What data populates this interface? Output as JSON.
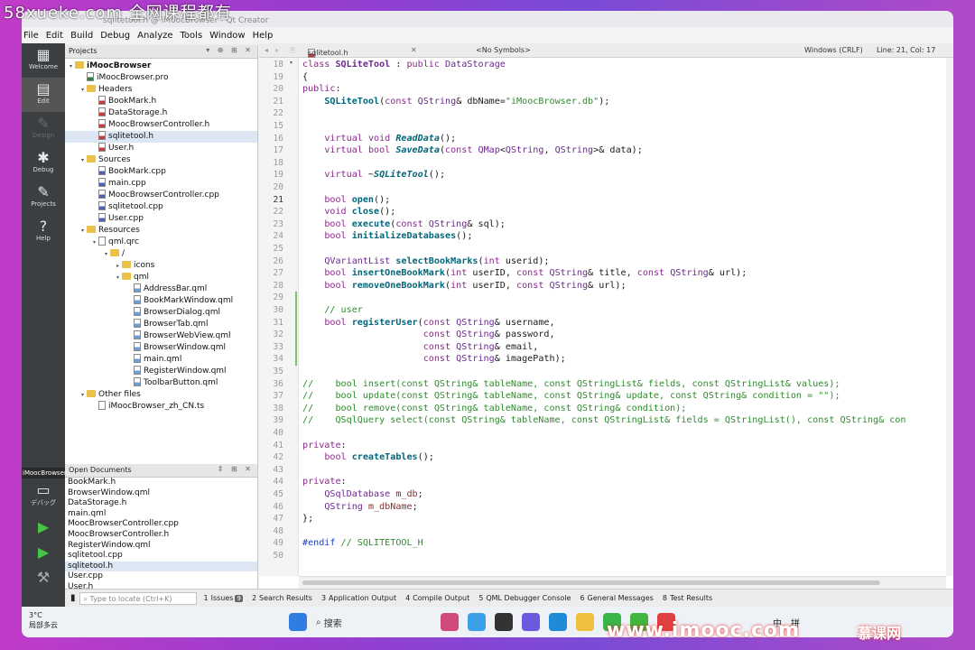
{
  "watermark": {
    "top_text": "58xueke.com 全网课程都有",
    "bottom_url": "www.imooc.com",
    "bottom_logo": "慕课网",
    "center_text": "58xueke.com"
  },
  "window": {
    "title": "sqlitetool.h @ iMoocBrowser - Qt Creator"
  },
  "menu": [
    "File",
    "Edit",
    "Build",
    "Debug",
    "Analyze",
    "Tools",
    "Window",
    "Help"
  ],
  "mode_rail": [
    {
      "label": "Welcome",
      "icon": "grid-icon"
    },
    {
      "label": "Edit",
      "icon": "edit-icon"
    },
    {
      "label": "Design",
      "icon": "pen-icon"
    },
    {
      "label": "Debug",
      "icon": "bug-icon"
    },
    {
      "label": "Projects",
      "icon": "wrench-icon"
    },
    {
      "label": "Help",
      "icon": "help-icon"
    }
  ],
  "kit": {
    "project": "iMoocBrowser",
    "config": "デバッグ"
  },
  "projects_panel": {
    "title": "Projects"
  },
  "tree": [
    {
      "label": "iMoocBrowser",
      "kind": "project",
      "level": 0,
      "arrow": "▾"
    },
    {
      "label": "iMoocBrowser.pro",
      "kind": "pro",
      "level": 1,
      "arrow": ""
    },
    {
      "label": "Headers",
      "kind": "folder",
      "level": 1,
      "arrow": "▾"
    },
    {
      "label": "BookMark.h",
      "kind": "h",
      "level": 2,
      "arrow": ""
    },
    {
      "label": "DataStorage.h",
      "kind": "h",
      "level": 2,
      "arrow": ""
    },
    {
      "label": "MoocBrowserController.h",
      "kind": "h",
      "level": 2,
      "arrow": ""
    },
    {
      "label": "sqlitetool.h",
      "kind": "h",
      "level": 2,
      "arrow": "",
      "selected": true
    },
    {
      "label": "User.h",
      "kind": "h",
      "level": 2,
      "arrow": ""
    },
    {
      "label": "Sources",
      "kind": "folder",
      "level": 1,
      "arrow": "▾"
    },
    {
      "label": "BookMark.cpp",
      "kind": "cpp",
      "level": 2,
      "arrow": ""
    },
    {
      "label": "main.cpp",
      "kind": "cpp",
      "level": 2,
      "arrow": ""
    },
    {
      "label": "MoocBrowserController.cpp",
      "kind": "cpp",
      "level": 2,
      "arrow": ""
    },
    {
      "label": "sqlitetool.cpp",
      "kind": "cpp",
      "level": 2,
      "arrow": ""
    },
    {
      "label": "User.cpp",
      "kind": "cpp",
      "level": 2,
      "arrow": ""
    },
    {
      "label": "Resources",
      "kind": "folder",
      "level": 1,
      "arrow": "▾"
    },
    {
      "label": "qml.qrc",
      "kind": "qrc",
      "level": 2,
      "arrow": "▾"
    },
    {
      "label": "/",
      "kind": "folder",
      "level": 3,
      "arrow": "▾"
    },
    {
      "label": "icons",
      "kind": "folder",
      "level": 4,
      "arrow": "▸"
    },
    {
      "label": "qml",
      "kind": "folder",
      "level": 4,
      "arrow": "▾"
    },
    {
      "label": "AddressBar.qml",
      "kind": "qml",
      "level": 5,
      "arrow": ""
    },
    {
      "label": "BookMarkWindow.qml",
      "kind": "qml",
      "level": 5,
      "arrow": ""
    },
    {
      "label": "BrowserDialog.qml",
      "kind": "qml",
      "level": 5,
      "arrow": ""
    },
    {
      "label": "BrowserTab.qml",
      "kind": "qml",
      "level": 5,
      "arrow": ""
    },
    {
      "label": "BrowserWebView.qml",
      "kind": "qml",
      "level": 5,
      "arrow": ""
    },
    {
      "label": "BrowserWindow.qml",
      "kind": "qml",
      "level": 5,
      "arrow": ""
    },
    {
      "label": "main.qml",
      "kind": "qml",
      "level": 5,
      "arrow": ""
    },
    {
      "label": "RegisterWindow.qml",
      "kind": "qml",
      "level": 5,
      "arrow": ""
    },
    {
      "label": "ToolbarButton.qml",
      "kind": "qml",
      "level": 5,
      "arrow": ""
    },
    {
      "label": "Other files",
      "kind": "folder",
      "level": 1,
      "arrow": "▾"
    },
    {
      "label": "iMoocBrowser_zh_CN.ts",
      "kind": "ts",
      "level": 2,
      "arrow": ""
    }
  ],
  "open_documents": {
    "title": "Open Documents",
    "items": [
      "BookMark.h",
      "BrowserWindow.qml",
      "DataStorage.h",
      "main.qml",
      "MoocBrowserController.cpp",
      "MoocBrowserController.h",
      "RegisterWindow.qml",
      "sqlitetool.cpp",
      "sqlitetool.h",
      "User.cpp",
      "User.h"
    ]
  },
  "editor_toolbar": {
    "file": "sqlitetool.h",
    "symbols": "<No Symbols>",
    "line_ending": "Windows (CRLF)",
    "position": "Line: 21, Col: 17"
  },
  "code_lines": [
    {
      "n": 18,
      "html": "<span style='color:#8a2a8a'>class</span> <b style='color:#6a2a8a'>SQLiteTool</b> : <span style='color:#8a2a8a'>public</span> <span style='color:#6a2a8a'>DataStorage</span>"
    },
    {
      "n": 19,
      "html": "{"
    },
    {
      "n": 20,
      "html": "<span style='color:#8a2a8a'>public</span>:"
    },
    {
      "n": 21,
      "html": "    <b style='color:#00677c'>SQLiteTool</b>(<span style='color:#8a2a8a'>const</span> <span style='color:#6a2a8a'>QString</span>&amp; dbName=<span style='color:#2e8b2e'>\"iMoocBrowser.db\"</span>);"
    },
    {
      "n": 22,
      "html": ""
    },
    {
      "n": 15,
      "html": ""
    },
    {
      "n": 16,
      "html": "    <span style='color:#8a2a8a'>virtual</span> <span style='color:#8a2a8a'>void</span> <b style='color:#00677c;font-style:italic'>ReadData</b>();"
    },
    {
      "n": 17,
      "html": "    <span style='color:#8a2a8a'>virtual</span> <span style='color:#8a2a8a'>bool</span> <b style='color:#00677c;font-style:italic'>SaveData</b>(<span style='color:#8a2a8a'>const</span> <span style='color:#6a2a8a'>QMap</span>&lt;<span style='color:#6a2a8a'>QString</span>, <span style='color:#6a2a8a'>QString</span>&gt;&amp; data);"
    },
    {
      "n": 18,
      "html": ""
    },
    {
      "n": 19,
      "html": "    <span style='color:#8a2a8a'>virtual</span> ~<b style='color:#00677c;font-style:italic'>SQLiteTool</b>();"
    },
    {
      "n": 20,
      "html": ""
    },
    {
      "n": 21,
      "html": "    <span style='color:#8a2a8a'>bool</span> <b style='color:#00677c'>open</b>();"
    },
    {
      "n": 22,
      "html": "    <span style='color:#8a2a8a'>void</span> <b style='color:#00677c'>close</b>();"
    },
    {
      "n": 23,
      "html": "    <span style='color:#8a2a8a'>bool</span> <b style='color:#00677c'>execute</b>(<span style='color:#8a2a8a'>const</span> <span style='color:#6a2a8a'>QString</span>&amp; sql);"
    },
    {
      "n": 24,
      "html": "    <span style='color:#8a2a8a'>bool</span> <b style='color:#00677c'>initializeDatabases</b>();"
    },
    {
      "n": 25,
      "html": ""
    },
    {
      "n": 26,
      "html": "    <span style='color:#6a2a8a'>QVariantList</span> <b style='color:#00677c'>selectBookMarks</b>(<span style='color:#8a2a8a'>int</span> userid);"
    },
    {
      "n": 27,
      "html": "    <span style='color:#8a2a8a'>bool</span> <b style='color:#00677c'>insertOneBookMark</b>(<span style='color:#8a2a8a'>int</span> userID, <span style='color:#8a2a8a'>const</span> <span style='color:#6a2a8a'>QString</span>&amp; title, <span style='color:#8a2a8a'>const</span> <span style='color:#6a2a8a'>QString</span>&amp; url);"
    },
    {
      "n": 28,
      "html": "    <span style='color:#8a2a8a'>bool</span> <b style='color:#00677c'>removeOneBookMark</b>(<span style='color:#8a2a8a'>int</span> userID, <span style='color:#8a2a8a'>const</span> <span style='color:#6a2a8a'>QString</span>&amp; url);"
    },
    {
      "n": 29,
      "html": ""
    },
    {
      "n": 30,
      "html": "    <span style='color:#2e8b2e'>// user</span>"
    },
    {
      "n": 31,
      "html": "    <span style='color:#8a2a8a'>bool</span> <b style='color:#00677c'>registerUser</b>(<span style='color:#8a2a8a'>const</span> <span style='color:#6a2a8a'>QString</span>&amp; username,"
    },
    {
      "n": 32,
      "html": "                      <span style='color:#8a2a8a'>const</span> <span style='color:#6a2a8a'>QString</span>&amp; password,"
    },
    {
      "n": 33,
      "html": "                      <span style='color:#8a2a8a'>const</span> <span style='color:#6a2a8a'>QString</span>&amp; email,"
    },
    {
      "n": 34,
      "html": "                      <span style='color:#8a2a8a'>const</span> <span style='color:#6a2a8a'>QString</span>&amp; imagePath);"
    },
    {
      "n": 35,
      "html": ""
    },
    {
      "n": 36,
      "html": "<span style='color:#2e8b2e'>//    bool insert(const QString&amp; tableName, const QStringList&amp; fields, const QStringList&amp; values);</span>"
    },
    {
      "n": 37,
      "html": "<span style='color:#2e8b2e'>//    bool update(const QString&amp; tableName, const QString&amp; update, const QString&amp; condition = \"\");</span>"
    },
    {
      "n": 38,
      "html": "<span style='color:#2e8b2e'>//    bool remove(const QString&amp; tableName, const QString&amp; condition);</span>"
    },
    {
      "n": 39,
      "html": "<span style='color:#2e8b2e'>//    QSqlQuery select(const QString&amp; tableName, const QStringList&amp; fields = QStringList(), const QString&amp; con</span>"
    },
    {
      "n": 40,
      "html": ""
    },
    {
      "n": 41,
      "html": "<span style='color:#8a2a8a'>private</span>:"
    },
    {
      "n": 42,
      "html": "    <span style='color:#8a2a8a'>bool</span> <b style='color:#00677c'>createTables</b>();"
    },
    {
      "n": 43,
      "html": ""
    },
    {
      "n": 44,
      "html": "<span style='color:#8a2a8a'>private</span>:"
    },
    {
      "n": 45,
      "html": "    <span style='color:#6a2a8a'>QSqlDatabase</span> <span style='color:#8a2a2a'>m_db</span>;"
    },
    {
      "n": 46,
      "html": "    <span style='color:#6a2a8a'>QString</span> <span style='color:#8a2a2a'>m_dbName</span>;"
    },
    {
      "n": 47,
      "html": "};"
    },
    {
      "n": 48,
      "html": ""
    },
    {
      "n": 49,
      "html": "<span style='color:#1f3fbf'>#endif</span> <span style='color:#2e8b2e'>// SQLITETOOL_H</span>"
    },
    {
      "n": 50,
      "html": ""
    }
  ],
  "statusbar": {
    "locate_placeholder": "Type to locate (Ctrl+K)",
    "items": [
      {
        "num": "1",
        "label": "Issues",
        "badge": "9"
      },
      {
        "num": "2",
        "label": "Search Results"
      },
      {
        "num": "3",
        "label": "Application Output"
      },
      {
        "num": "4",
        "label": "Compile Output"
      },
      {
        "num": "5",
        "label": "QML Debugger Console"
      },
      {
        "num": "6",
        "label": "General Messages"
      },
      {
        "num": "8",
        "label": "Test Results"
      }
    ]
  },
  "taskbar": {
    "weather_temp": "3°C",
    "weather_desc": "局部多云",
    "search_label": "搜索",
    "tray": [
      "中",
      "拼"
    ]
  },
  "colors": {
    "rail": "#3c3f41",
    "accent": "#00677c",
    "keyword": "#8a2a8a",
    "comment": "#2e8b2e"
  }
}
